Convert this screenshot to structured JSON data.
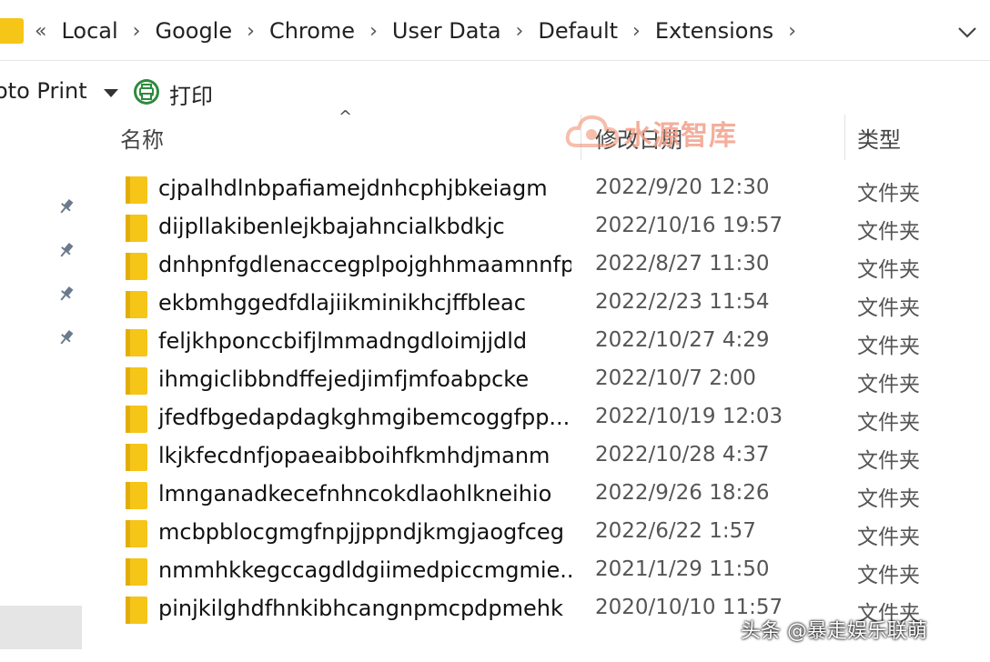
{
  "address_bar": {
    "crumbs": [
      "Local",
      "Google",
      "Chrome",
      "User Data",
      "Default",
      "Extensions"
    ],
    "overflow_glyph": "«",
    "separator_glyph": "›",
    "dropdown_icon": "chevron-down-icon"
  },
  "toolbar": {
    "print_label": "oto Print",
    "print_cn_label": "打印"
  },
  "columns": {
    "name": "名称",
    "date": "修改日期",
    "type": "类型"
  },
  "watermark": "水源智库",
  "credit": "头条 @暴走娱乐联萌",
  "colors": {
    "folder": "#f5c518",
    "folder_dark": "#e2ad0c",
    "printer": "#2e8b3e"
  },
  "rows": [
    {
      "name": "cjpalhdlnbpafiamejdnhcphjbkeiagm",
      "date": "2022/9/20 12:30",
      "type": "文件夹"
    },
    {
      "name": "dijpllakibenlejkbajahncialkbdkjc",
      "date": "2022/10/16 19:57",
      "type": "文件夹"
    },
    {
      "name": "dnhpnfgdlenaccegplpojghhmaamnnfp",
      "date": "2022/8/27 11:30",
      "type": "文件夹"
    },
    {
      "name": "ekbmhggedfdlajiikminikhcjffbleac",
      "date": "2022/2/23 11:54",
      "type": "文件夹"
    },
    {
      "name": "feljkhponccbifjlmmadngdloimjjdld",
      "date": "2022/10/27 4:29",
      "type": "文件夹"
    },
    {
      "name": "ihmgiclibbndffejedjimfjmfoabpcke",
      "date": "2022/10/7 2:00",
      "type": "文件夹"
    },
    {
      "name": "jfedfbgedapdagkghmgibemcoggfpp...",
      "date": "2022/10/19 12:03",
      "type": "文件夹"
    },
    {
      "name": "lkjkfecdnfjopaeaibboihfkmhdjmanm",
      "date": "2022/10/28 4:37",
      "type": "文件夹"
    },
    {
      "name": "lmnganadkecefnhncokdlaohlkneihio",
      "date": "2022/9/26 18:26",
      "type": "文件夹"
    },
    {
      "name": "mcbpblocgmgfnpjjppndjkmgjaogfceg",
      "date": "2022/6/22 1:57",
      "type": "文件夹"
    },
    {
      "name": "nmmhkkegccagdldgiimedpiccmgmie...",
      "date": "2021/1/29 11:50",
      "type": "文件夹"
    },
    {
      "name": "pinjkilghdfhnkibhcangnpmcpdpmehk",
      "date": "2020/10/10 11:57",
      "type": "文件夹"
    }
  ]
}
